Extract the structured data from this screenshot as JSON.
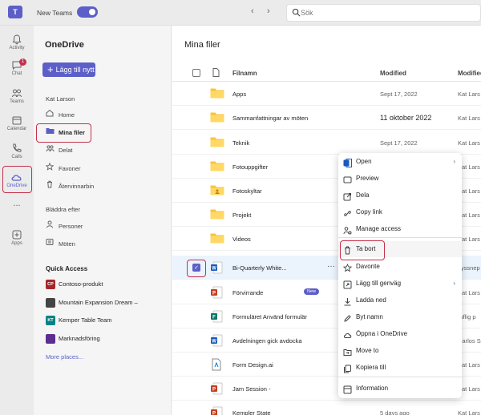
{
  "topbar": {
    "new_teams_label": "New Teams",
    "search_placeholder": "Sök"
  },
  "rail": {
    "items": [
      {
        "label": "Activity"
      },
      {
        "label": "Chat",
        "badge": "1"
      },
      {
        "label": "Teams"
      },
      {
        "label": "Calendar"
      },
      {
        "label": "Calls"
      },
      {
        "label": "OneDrive"
      },
      {
        "label": "..."
      },
      {
        "label": "Apps"
      }
    ]
  },
  "leftpane": {
    "title": "OneDrive",
    "new_button": "Lägg till nytt",
    "user": "Kat Larson",
    "nav": [
      {
        "label": "Home"
      },
      {
        "label": "Mina filer"
      },
      {
        "label": "Delat"
      },
      {
        "label": "Favoner"
      },
      {
        "label": "Återvinnarbin"
      }
    ],
    "browse_label": "Bläddra efter",
    "browse": [
      {
        "label": "Personer"
      },
      {
        "label": "Möten"
      }
    ],
    "quick_access_title": "Quick Access",
    "quick_access": [
      {
        "badge": "CP",
        "label": "Contoso-produkt",
        "color": "#a4262c"
      },
      {
        "badge": "",
        "label": "Mountain Expansion Dream –",
        "color": "#444444"
      },
      {
        "badge": "KT",
        "label": "Kemper Table Team",
        "color": "#038387"
      },
      {
        "badge": "",
        "label": "Marknadsföring",
        "color": "#5c2e91"
      }
    ],
    "more_places": "More places..."
  },
  "main": {
    "title": "Mina filer",
    "columns": {
      "name": "Filnamn",
      "modified": "Modified",
      "modified_by": "Modified"
    },
    "rows": [
      {
        "type": "folder",
        "name": "Apps",
        "modified": "Sept 17, 2022",
        "by": "Kat Lars"
      },
      {
        "type": "folder",
        "name": "Sammanfattningar  av möten",
        "modified": "11 oktober 2022",
        "by": "Kat Lars"
      },
      {
        "type": "folder",
        "name": "Teknik",
        "modified": "Sept 17, 2022",
        "by": "Kat Lars"
      },
      {
        "type": "folder",
        "name": "Fotouppgifter",
        "modified": "",
        "by": "Kat Lars"
      },
      {
        "type": "folder-shared",
        "name": "Fotoskyltar",
        "modified": "",
        "by": "Kat Lars"
      },
      {
        "type": "folder",
        "name": "Projekt",
        "modified": "",
        "by": "Kat Lars"
      },
      {
        "type": "folder",
        "name": "Videos",
        "modified": "",
        "by": "Kat Lars"
      },
      {
        "type": "word",
        "name": "Bi-Quarterly White...",
        "modified": "",
        "by": "Lyssnep",
        "selected": true
      },
      {
        "type": "ppt",
        "name": "Förvirrande",
        "modified": "",
        "by": "Kat Lars",
        "new": "New"
      },
      {
        "type": "forms",
        "name": "Formuläret Använd formulär",
        "modified": "",
        "by": "ruflig p"
      },
      {
        "type": "word",
        "name": "Avdelningen  gick avdocka",
        "modified": "",
        "by": "Carlos S"
      },
      {
        "type": "ai",
        "name": "Form Design.ai",
        "modified": "",
        "by": "Kat Lars"
      },
      {
        "type": "ppt",
        "name": "Jam  Session -",
        "modified": "",
        "by": "Kat Lars"
      },
      {
        "type": "ppt",
        "name": "Kempler State",
        "modified": "5 days ago",
        "by": "Kat Lars"
      }
    ]
  },
  "context_menu": {
    "items": [
      {
        "label": "Open",
        "icon": "word-icon",
        "chevron": true
      },
      {
        "label": "Preview",
        "icon": "eye-icon"
      },
      {
        "label": "Dela",
        "icon": "share-icon"
      },
      {
        "label": "Copy link",
        "icon": "link-icon"
      },
      {
        "label": "Manage access",
        "icon": "people-icon"
      },
      {
        "label": "Ta bort",
        "icon": "trash-icon"
      },
      {
        "label": "Davonte",
        "icon": "star-icon"
      },
      {
        "label": "Lägg till genväg",
        "icon": "shortcut-icon",
        "chevron": true
      },
      {
        "label": "Ladda ned",
        "icon": "download-icon"
      },
      {
        "label": "Byt namn",
        "icon": "rename-icon"
      },
      {
        "label": "Öppna i   OneDrive",
        "icon": "cloud-icon"
      },
      {
        "label": "Move to",
        "icon": "move-icon"
      },
      {
        "label": "Kopiera till",
        "icon": "copy-icon"
      },
      {
        "label": "Information",
        "icon": "info-icon"
      }
    ]
  }
}
